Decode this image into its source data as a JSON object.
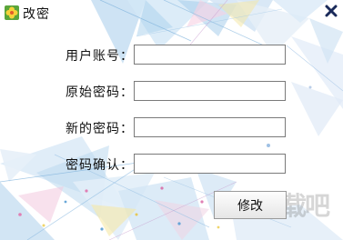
{
  "window": {
    "title": "改密",
    "app_icon": "flower-icon",
    "close_icon": "close-icon"
  },
  "form": {
    "username_label": "用户账号：",
    "old_password_label": "原始密码：",
    "new_password_label": "新的密码：",
    "confirm_password_label": "密码确认：",
    "username_value": "",
    "old_password_value": "",
    "new_password_value": "",
    "confirm_password_value": "",
    "submit_label": "修改"
  },
  "watermark": {
    "text": "下载吧"
  },
  "colors": {
    "accent_blue": "#5aa7d8",
    "pink": "#e79ac4",
    "yellow": "#f1e08a"
  }
}
